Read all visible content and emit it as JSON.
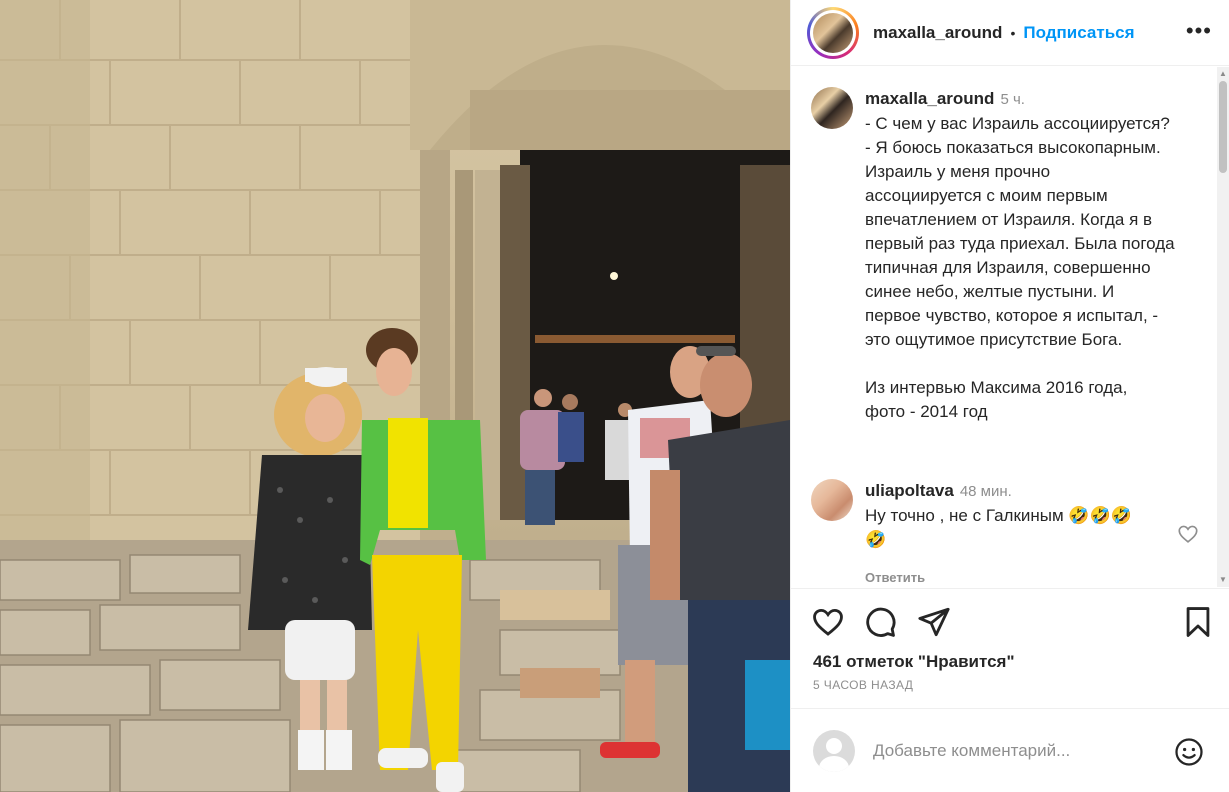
{
  "header": {
    "username": "maxalla_around",
    "separator": "•",
    "follow_label": "Подписаться",
    "more_label": "•••"
  },
  "caption": {
    "username": "maxalla_around",
    "time": "5 ч.",
    "lines": [
      "- С чем у вас Израиль ассоциируется?",
      "- Я боюсь показаться высокопарным.",
      "Израиль у меня прочно",
      "ассоциируется с моим первым",
      "впечатлением от Израиля. Когда я в",
      "первый раз туда приехал. Была погода",
      "типичная для Израиля, совершенно",
      "синее небо, желтые пустыни. И",
      "первое чувство, которое я испытал, -",
      "это ощутимое присутствие Бога.",
      " ",
      "Из интервью Максима 2016 года,",
      "фото - 2014 год"
    ]
  },
  "comment": {
    "username": "uliapoltava",
    "time": "48 мин.",
    "text_line1": "Ну точно , не с Галкиным 🤣🤣🤣",
    "text_line2": "🤣",
    "reply_label": "Ответить"
  },
  "actions": {
    "likes": "461 отметок \"Нравится\"",
    "posted_ago": "5 ЧАСОВ НАЗАД"
  },
  "add_comment": {
    "placeholder": "Добавьте комментарий..."
  },
  "icons": [
    "heart-icon",
    "comment-icon",
    "share-icon",
    "bookmark-icon",
    "emoji-icon",
    "more-icon"
  ],
  "colors": {
    "accent": "#0095f6",
    "text": "#262626",
    "muted": "#8e8e8e",
    "border": "#efefef"
  }
}
